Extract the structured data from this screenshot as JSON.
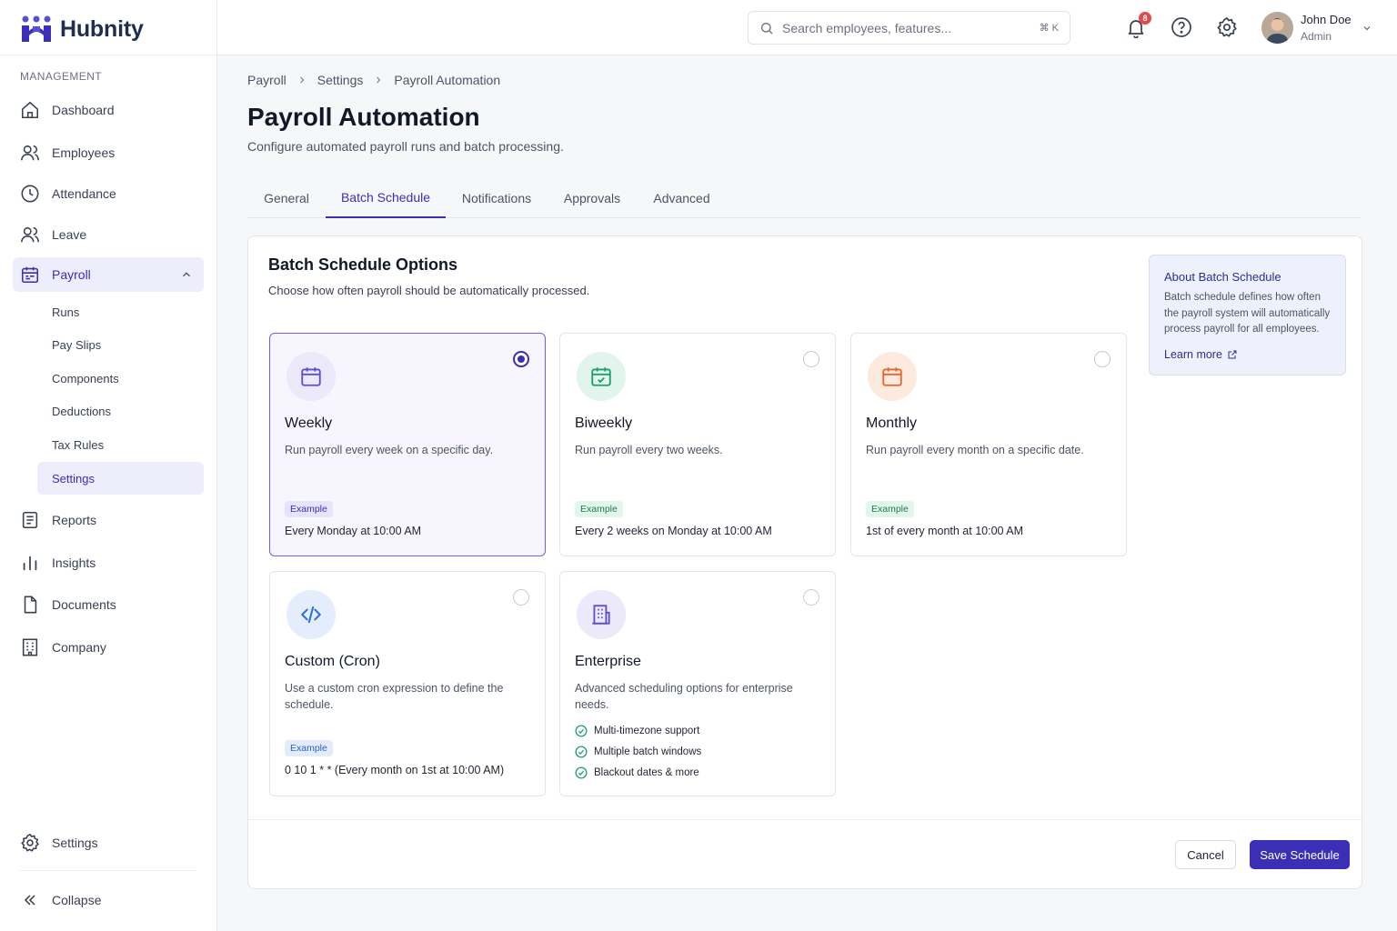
{
  "app": {
    "name": "Hubnity",
    "accent": "#3a2fb5"
  },
  "sidebar": {
    "section_label": "MANAGEMENT",
    "items": [
      {
        "label": "Dashboard",
        "icon": "home-icon"
      },
      {
        "label": "Employees",
        "icon": "users-icon"
      },
      {
        "label": "Attendance",
        "icon": "clock-icon"
      },
      {
        "label": "Leave",
        "icon": "users-icon"
      },
      {
        "label": "Payroll",
        "icon": "calendar-icon",
        "active": true,
        "expanded": true
      },
      {
        "label": "Reports",
        "icon": "report-icon"
      },
      {
        "label": "Insights",
        "icon": "bar-chart-icon"
      },
      {
        "label": "Documents",
        "icon": "document-icon"
      },
      {
        "label": "Company",
        "icon": "building-icon"
      }
    ],
    "payroll_sub": [
      "Runs",
      "Pay Slips",
      "Components",
      "Deductions",
      "Tax Rules",
      "Settings"
    ],
    "payroll_sub_active": "Settings",
    "settings_label": "Settings",
    "collapse_label": "Collapse"
  },
  "topbar": {
    "search_placeholder": "Search employees, features...",
    "search_shortcut": "⌘ K",
    "notification_count": "8",
    "user": {
      "name": "John Doe",
      "role": "Admin"
    }
  },
  "breadcrumb": [
    "Payroll",
    "Settings",
    "Payroll Automation"
  ],
  "page": {
    "title": "Payroll Automation",
    "subtitle": "Configure automated payroll runs and batch processing."
  },
  "tabs": [
    {
      "label": "General"
    },
    {
      "label": "Batch Schedule",
      "active": true
    },
    {
      "label": "Notifications"
    },
    {
      "label": "Approvals"
    },
    {
      "label": "Advanced"
    }
  ],
  "panel": {
    "title": "Batch Schedule Options",
    "subtitle": "Choose how often payroll should be automatically processed."
  },
  "options": [
    {
      "title": "Weekly",
      "description": "Run payroll every week on a specific day.",
      "tag": "Example",
      "example": "Every Monday at 10:00 AM",
      "selected": true,
      "icon": "calendar-icon",
      "color": "#5b4fd1",
      "bg": "#ebe9fa",
      "tag_bg": "#e6e4fb",
      "tag_color": "#3a2fb5"
    },
    {
      "title": "Biweekly",
      "description": "Run payroll every two weeks.",
      "tag": "Example",
      "example": "Every 2 weeks on Monday at 10:00 AM",
      "selected": false,
      "icon": "calendar-check-icon",
      "color": "#1f9d6a",
      "bg": "#e2f5ec",
      "tag_bg": "#e3f6ec",
      "tag_color": "#1a7f55"
    },
    {
      "title": "Monthly",
      "description": "Run payroll every month on a specific date.",
      "tag": "Example",
      "example": "1st of every month at 10:00 AM",
      "selected": false,
      "icon": "calendar-icon",
      "color": "#e0672d",
      "bg": "#fdeade",
      "tag_bg": "#e3f6ec",
      "tag_color": "#1a7f55"
    },
    {
      "title": "Custom (Cron)",
      "description": "Use a custom cron expression to define the schedule.",
      "tag": "Example",
      "example": "0 10 1 * * (Every month on 1st at 10:00 AM)",
      "selected": false,
      "icon": "code-icon",
      "color": "#2d6fd6",
      "bg": "#e3edfb",
      "tag_bg": "#e3ecfb",
      "tag_color": "#2d5fc2"
    },
    {
      "title": "Enterprise",
      "description": "Advanced scheduling options for enterprise needs.",
      "selected": false,
      "icon": "building-icon",
      "color": "#5b4fd1",
      "bg": "#ebe9fa",
      "features": [
        "Multi-timezone support",
        "Multiple batch windows",
        "Blackout dates & more"
      ]
    }
  ],
  "about": {
    "title": "About Batch Schedule",
    "body": "Batch schedule defines how often the payroll system will automatically process payroll for all employees.",
    "link": "Learn more"
  },
  "actions": {
    "cancel": "Cancel",
    "save": "Save Schedule"
  }
}
